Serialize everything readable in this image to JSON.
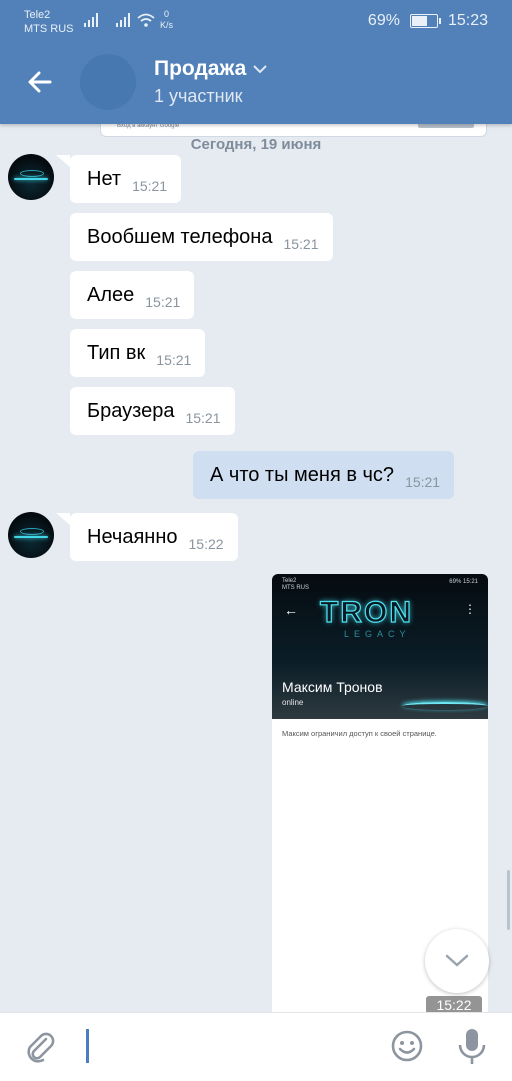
{
  "status_bar": {
    "carrier1": "Tele2",
    "carrier2": "MTS RUS",
    "speed_value": "0",
    "speed_unit": "K/s",
    "battery_pct": "69%",
    "time": "15:23",
    "battery_level": 0.69
  },
  "header": {
    "title": "Продажа",
    "subtitle": "1 участник"
  },
  "previous_message": {
    "preview_text": "Вход в аккаунт Google"
  },
  "date_separator": "Сегодня, 19 июня",
  "messages": [
    {
      "dir": "in",
      "text": "Нет",
      "time": "15:21"
    },
    {
      "dir": "in",
      "text": "Вообшем телефона",
      "time": "15:21"
    },
    {
      "dir": "in",
      "text": "Алее",
      "time": "15:21"
    },
    {
      "dir": "in",
      "text": "Тип вк",
      "time": "15:21"
    },
    {
      "dir": "in",
      "text": "Браузера",
      "time": "15:21"
    },
    {
      "dir": "out",
      "text": "А что ты меня в чс?",
      "time": "15:21"
    },
    {
      "dir": "in",
      "text": "Нечаянно",
      "time": "15:22"
    }
  ],
  "image_message": {
    "time": "15:22",
    "screenshot": {
      "carrier1": "Tele2",
      "carrier2": "MTS RUS",
      "battery": "69%",
      "clock": "15:21",
      "logo": "TRON",
      "logo_sub": "LEGACY",
      "profile_name": "Максим Тронов",
      "status": "online",
      "notice": "Максим ограничил доступ к своей странице."
    }
  },
  "icons": {
    "back": "arrow-left-icon",
    "dropdown": "chevron-down-icon",
    "scroll_down": "chevron-down-icon",
    "attach": "paperclip-icon",
    "emoji": "smile-icon",
    "mic": "microphone-icon"
  },
  "colors": {
    "header": "#5181b8",
    "background": "#e6ebf1",
    "incoming_bubble": "#ffffff",
    "outgoing_bubble": "#cfdff1",
    "accent": "#4a7fbf"
  }
}
